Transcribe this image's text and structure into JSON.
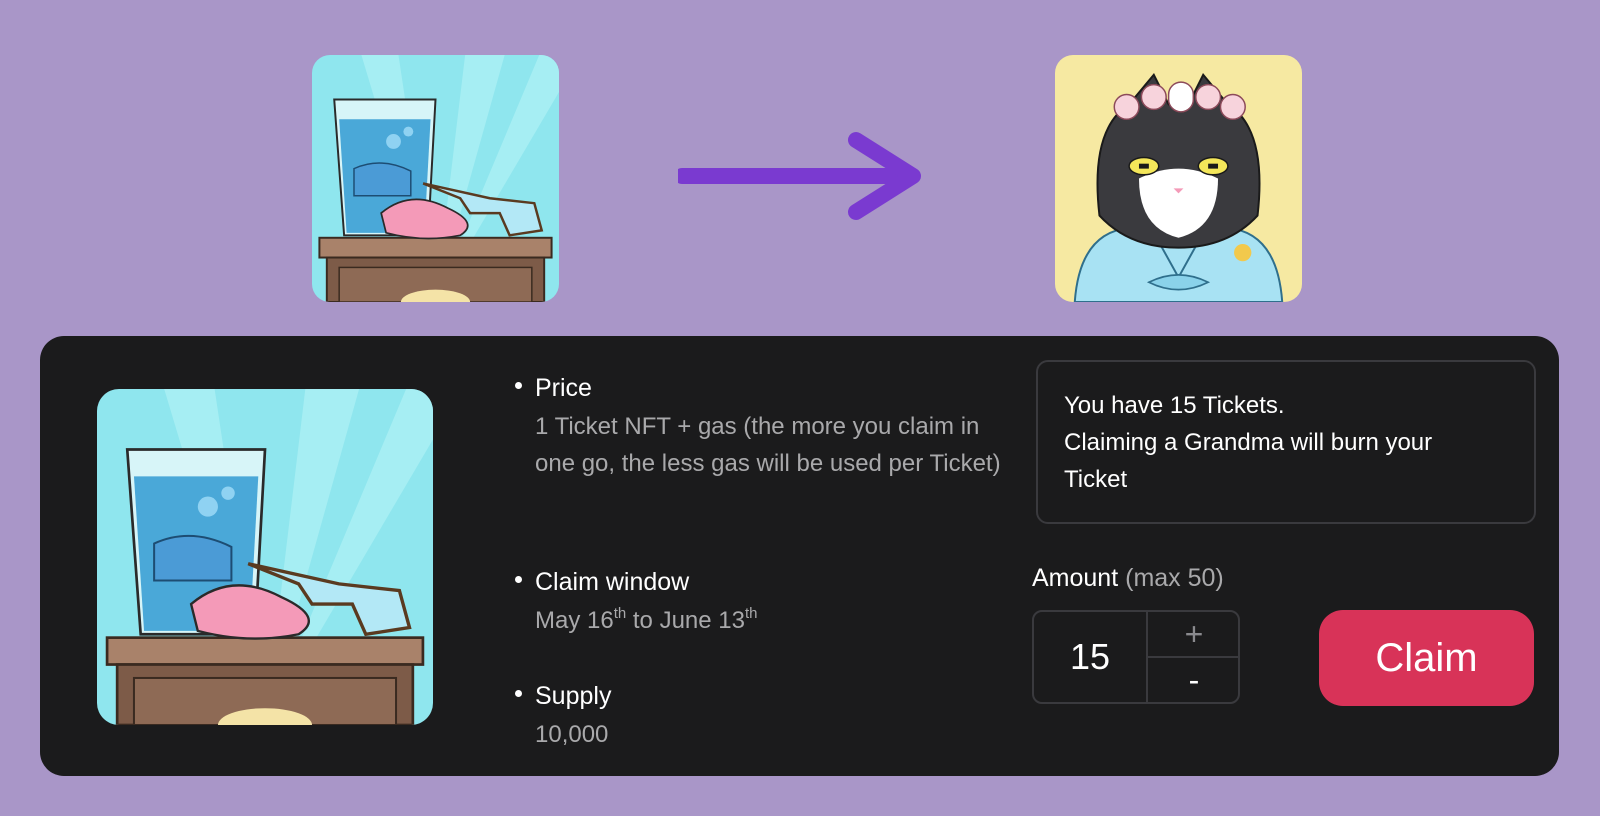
{
  "banner": {
    "from_image": "ticket-nft-illustration",
    "arrow_icon": "arrow-right-icon",
    "to_image": "grandma-cat-nft-illustration"
  },
  "details": {
    "price": {
      "label": "Price",
      "value": "1 Ticket NFT + gas (the more you claim in one go, the less gas will be used per Ticket)"
    },
    "claim_window": {
      "label": "Claim window",
      "start": "May 16",
      "start_suffix": "th",
      "connector": " to ",
      "end": "June 13",
      "end_suffix": "th"
    },
    "supply": {
      "label": "Supply",
      "value": "10,000"
    }
  },
  "notice": {
    "line1": "You have 15 Tickets.",
    "line2": "Claiming a Grandma will burn your",
    "line3": "Ticket"
  },
  "amount": {
    "label": "Amount",
    "max": "(max 50)",
    "value": "15",
    "increment": "+",
    "decrement": "-"
  },
  "claim_button": "Claim",
  "colors": {
    "background": "#a996c8",
    "panel": "#1b1b1c",
    "arrow": "#7a3ad0",
    "claim": "#d83358"
  }
}
